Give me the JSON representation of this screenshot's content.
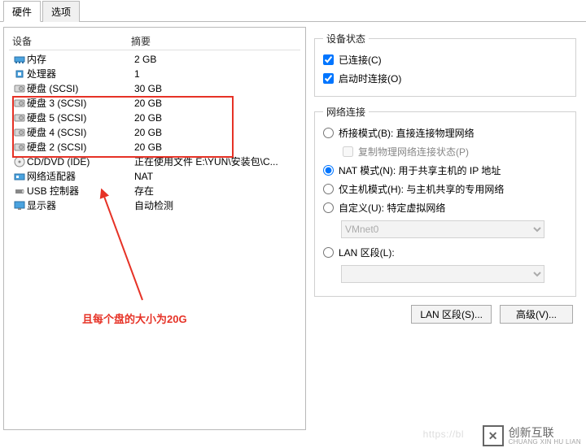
{
  "tabs": {
    "hardware": "硬件",
    "options": "选项"
  },
  "headers": {
    "device": "设备",
    "summary": "摘要"
  },
  "devices": [
    {
      "icon": "memory",
      "name": "内存",
      "summary": "2 GB"
    },
    {
      "icon": "cpu",
      "name": "处理器",
      "summary": "1"
    },
    {
      "icon": "hdd",
      "name": "硬盘 (SCSI)",
      "summary": "30 GB"
    },
    {
      "icon": "hdd",
      "name": "硬盘 3 (SCSI)",
      "summary": "20 GB"
    },
    {
      "icon": "hdd",
      "name": "硬盘 5 (SCSI)",
      "summary": "20 GB"
    },
    {
      "icon": "hdd",
      "name": "硬盘 4 (SCSI)",
      "summary": "20 GB"
    },
    {
      "icon": "hdd",
      "name": "硬盘 2 (SCSI)",
      "summary": "20 GB"
    },
    {
      "icon": "cd",
      "name": "CD/DVD (IDE)",
      "summary": "正在使用文件 E:\\YUN\\安装包\\C..."
    },
    {
      "icon": "net",
      "name": "网络适配器",
      "summary": "NAT"
    },
    {
      "icon": "usb",
      "name": "USB 控制器",
      "summary": "存在"
    },
    {
      "icon": "display",
      "name": "显示器",
      "summary": "自动检测"
    }
  ],
  "annotation": "且每个盘的大小为20G",
  "device_status": {
    "legend": "设备状态",
    "connected": "已连接(C)",
    "connect_power": "启动时连接(O)"
  },
  "network": {
    "legend": "网络连接",
    "bridge": "桥接模式(B): 直接连接物理网络",
    "replicate": "复制物理网络连接状态(P)",
    "nat": "NAT 模式(N): 用于共享主机的 IP 地址",
    "hostonly": "仅主机模式(H): 与主机共享的专用网络",
    "custom": "自定义(U): 特定虚拟网络",
    "vmnet": "VMnet0",
    "lanseg": "LAN 区段(L):",
    "lanseg_sel": ""
  },
  "buttons": {
    "lanseg": "LAN 区段(S)...",
    "advanced": "高级(V)..."
  },
  "watermark": {
    "brand": "创新互联",
    "sub": "CHUANG XIN HU LIAN",
    "faint": "https://bl"
  }
}
